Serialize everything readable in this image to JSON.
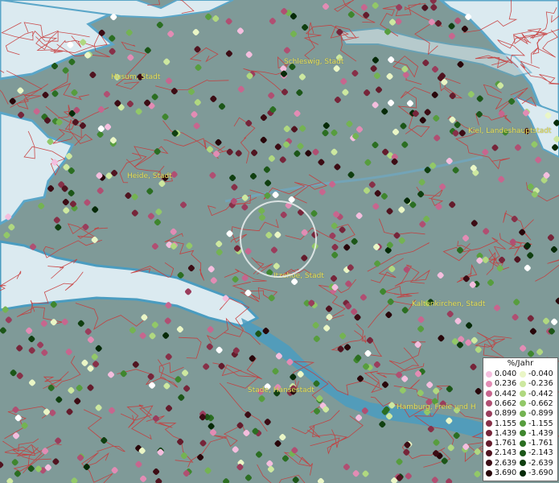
{
  "towns": [
    {
      "name": "Schleswig, Stadt"
    },
    {
      "name": "Husum, Stadt"
    },
    {
      "name": "Kiel, Landeshauptstadt"
    },
    {
      "name": "Heide, Stadt"
    },
    {
      "name": "Itzehoe, Stadt"
    },
    {
      "name": "Kaltenkirchen, Stadt"
    },
    {
      "name": "Stade, Hansestadt"
    },
    {
      "name": "Hamburg, Freie und H"
    }
  ],
  "legend": {
    "title": "%/Jahr",
    "positive": [
      {
        "label": "0.040",
        "color": "#f4bede"
      },
      {
        "label": "0.236",
        "color": "#e28cb4"
      },
      {
        "label": "0.442",
        "color": "#c7668e"
      },
      {
        "label": "0.662",
        "color": "#b04f72"
      },
      {
        "label": "0.899",
        "color": "#9a3d5c"
      },
      {
        "label": "1.155",
        "color": "#873048"
      },
      {
        "label": "1.439",
        "color": "#76253a"
      },
      {
        "label": "1.761",
        "color": "#641c2c"
      },
      {
        "label": "2.143",
        "color": "#501420"
      },
      {
        "label": "2.639",
        "color": "#3c0c14"
      },
      {
        "label": "3.690",
        "color": "#28060a"
      }
    ],
    "negative": [
      {
        "label": "-0.040",
        "color": "#eaf6c6"
      },
      {
        "label": "-0.236",
        "color": "#cde8a0"
      },
      {
        "label": "-0.442",
        "color": "#b0d880"
      },
      {
        "label": "-0.662",
        "color": "#92c868"
      },
      {
        "label": "-0.899",
        "color": "#74b352"
      },
      {
        "label": "-1.155",
        "color": "#579d3e"
      },
      {
        "label": "-1.439",
        "color": "#3f862e"
      },
      {
        "label": "-1.761",
        "color": "#2b6e22"
      },
      {
        "label": "-2.143",
        "color": "#1c5618"
      },
      {
        "label": "-2.639",
        "color": "#103f10"
      },
      {
        "label": "-3.690",
        "color": "#062a08"
      }
    ]
  },
  "colors": {
    "land": "#7f9a98",
    "water": "#dbeaf0",
    "coast": "#4a9cc0",
    "border": "#c83a3a",
    "label": "#e8e060"
  }
}
